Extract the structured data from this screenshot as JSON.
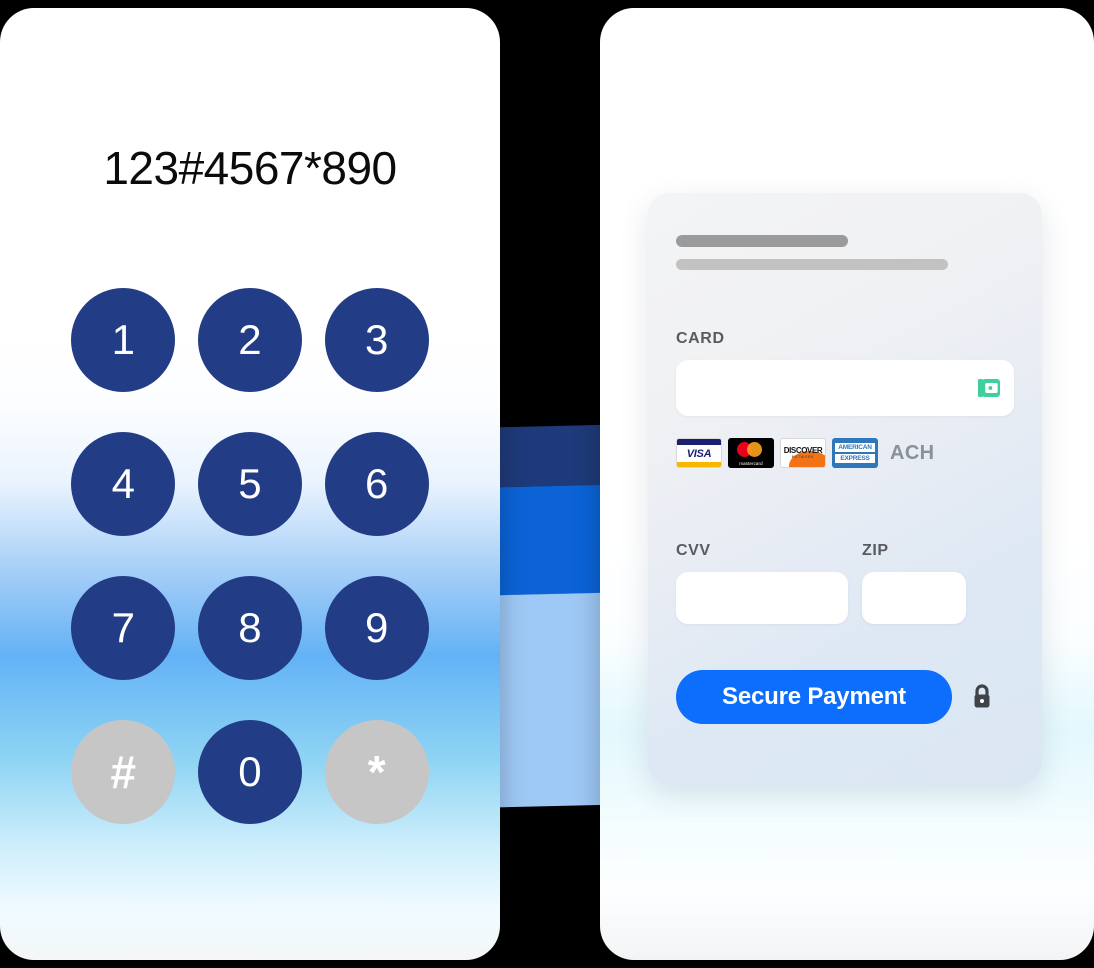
{
  "keypad": {
    "display_value": "123#4567*890",
    "keys": [
      {
        "label": "1",
        "style": "navy"
      },
      {
        "label": "2",
        "style": "navy"
      },
      {
        "label": "3",
        "style": "navy"
      },
      {
        "label": "4",
        "style": "navy"
      },
      {
        "label": "5",
        "style": "navy"
      },
      {
        "label": "6",
        "style": "navy"
      },
      {
        "label": "7",
        "style": "navy"
      },
      {
        "label": "8",
        "style": "navy"
      },
      {
        "label": "9",
        "style": "navy"
      },
      {
        "label": "#",
        "style": "grey"
      },
      {
        "label": "0",
        "style": "navy"
      },
      {
        "label": "*",
        "style": "grey"
      }
    ],
    "key_navy_color": "#223c86",
    "key_grey_color": "#c6c6c6"
  },
  "payment": {
    "card_label": "CARD",
    "card_input_value": "",
    "card_input_placeholder": "",
    "wallet_icon": "wallet-icon",
    "wallet_icon_color": "#3ecf9b",
    "brands": [
      {
        "name": "visa",
        "text": "VISA"
      },
      {
        "name": "mastercard",
        "text": "mastercard"
      },
      {
        "name": "discover",
        "text": "DISCOVER",
        "sub": "NETWORK"
      },
      {
        "name": "american-express",
        "line1": "AMERICAN",
        "line2": "EXPRESS"
      }
    ],
    "ach_label": "ACH",
    "cvv_label": "CVV",
    "cvv_value": "",
    "zip_label": "ZIP",
    "zip_value": "",
    "submit_label": "Secure Payment",
    "submit_color": "#0d6efd",
    "lock_icon": "lock-icon",
    "lock_icon_color": "#3f4448"
  },
  "background": {
    "page_color": "#000000",
    "band_navy": "#1f3a7a",
    "band_blue": "#0b63d6",
    "band_light": "#9ec8f5"
  }
}
